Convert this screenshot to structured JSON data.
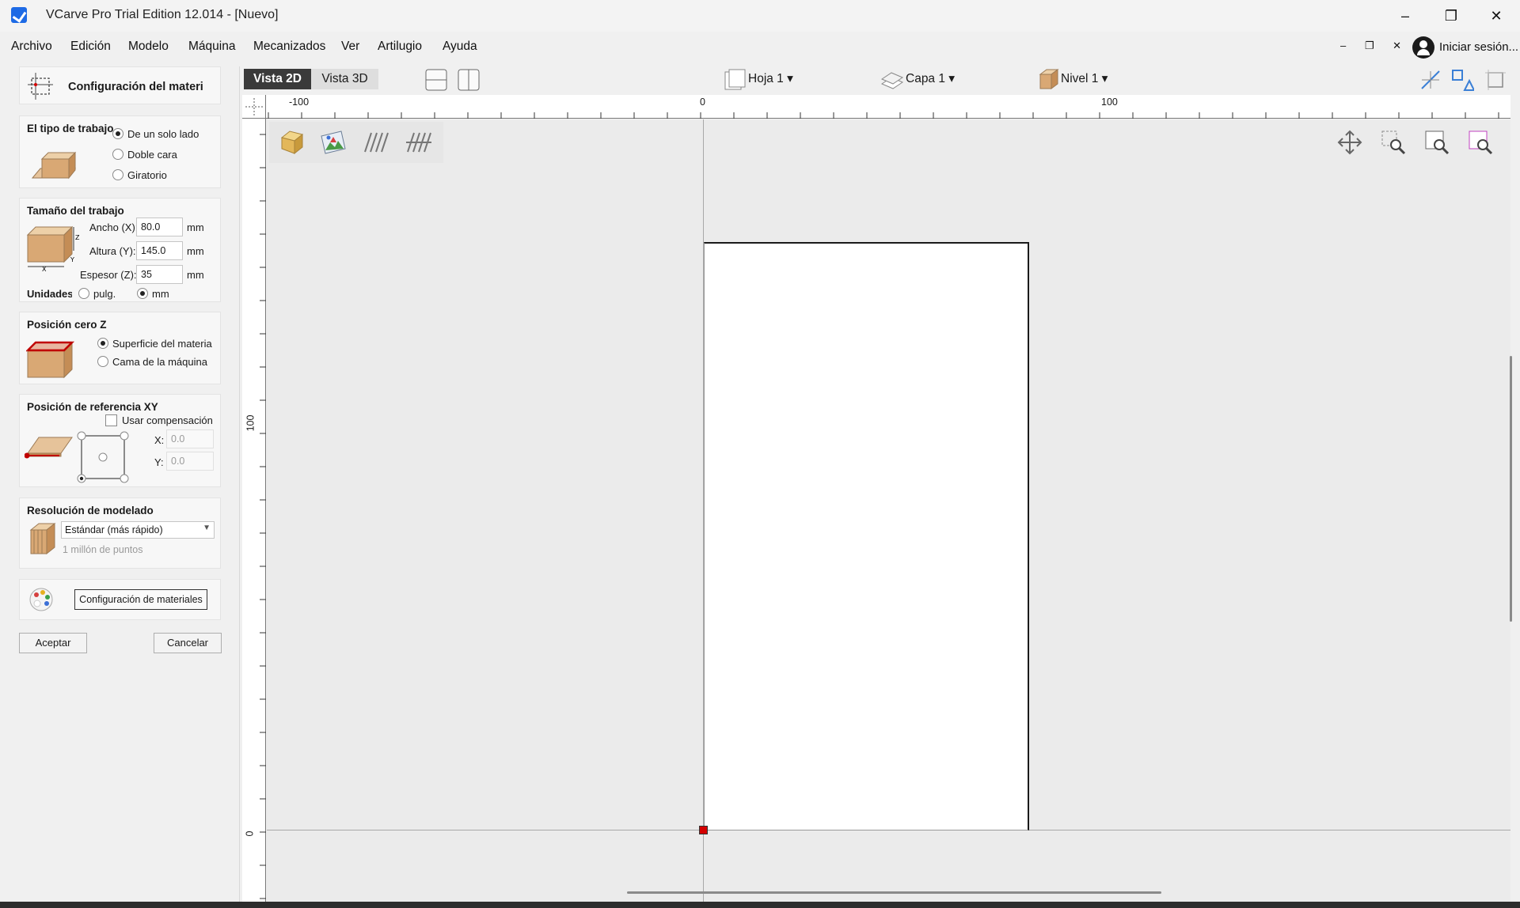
{
  "window": {
    "title": "VCarve Pro Trial Edition 12.014 - [Nuevo]",
    "minimize_glyph": "–",
    "restore_glyph": "❐",
    "close_glyph": "✕"
  },
  "menu": {
    "items": [
      "Archivo",
      "Edición",
      "Modelo",
      "Máquina",
      "Mecanizados",
      "Ver",
      "Artilugio",
      "Ayuda"
    ],
    "mdi_controls": "– ❐ ✕",
    "login_label": "Iniciar sesión..."
  },
  "panel": {
    "header_title": "Configuración del materi",
    "job_type": {
      "title": "El tipo de trabajo",
      "options": [
        "De un solo lado",
        "Doble cara",
        "Giratorio"
      ],
      "selected": "De un solo lado"
    },
    "job_size": {
      "title": "Tamaño del trabajo",
      "width_label": "Ancho (X):",
      "width_value": "80.0",
      "height_label": "Altura (Y):",
      "height_value": "145.0",
      "thickness_label": "Espesor (Z):",
      "thickness_value": "35",
      "unit": "mm",
      "units_label": "Unidades",
      "units_options": [
        "pulg.",
        "mm"
      ],
      "units_selected": "mm"
    },
    "z_zero": {
      "title": "Posición cero Z",
      "options": [
        "Superficie del materia",
        "Cama de la máquina"
      ],
      "selected": "Superficie del materia"
    },
    "xy_datum": {
      "title": "Posición de referencia XY",
      "offset_label": "Usar compensación",
      "x_label": "X:",
      "x_value": "0.0",
      "y_label": "Y:",
      "y_value": "0.0"
    },
    "resolution": {
      "title": "Resolución de modelado",
      "selected": "Estándar (más rápido)",
      "subtext": "1 millón de puntos"
    },
    "materials_button": "Configuración de materiales",
    "ok_button": "Aceptar",
    "cancel_button": "Cancelar"
  },
  "viewbar": {
    "tab_2d": "Vista 2D",
    "tab_3d": "Vista 3D",
    "sheet": "Hoja 1 ▾",
    "layer": "Capa 1 ▾",
    "level": "Nivel 1 ▾"
  },
  "rulers": {
    "h_labels": [
      "-100",
      "0",
      "100"
    ],
    "v_labels": [
      "100",
      "0"
    ]
  },
  "colors": {
    "active_tab": "#3a3a3a",
    "origin_marker": "#d40000",
    "accent_blue": "#1d6ae5"
  }
}
